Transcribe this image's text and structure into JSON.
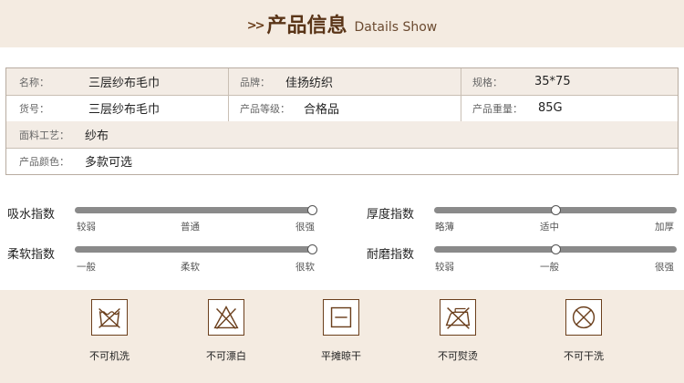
{
  "header": {
    "arrows": ">>",
    "title_zh": "产品信息",
    "title_en": "Datails  Show"
  },
  "spec": {
    "name_label": "名称：",
    "name_value": "三层纱布毛巾",
    "brand_label": "品牌：",
    "brand_value": "佳扬纺织",
    "size_label": "规格：",
    "size_value": "35*75",
    "item_no_label": "货号：",
    "item_no_value": "三层纱布毛巾",
    "grade_label": "产品等级：",
    "grade_value": "合格品",
    "weight_label": "产品重量：",
    "weight_value": "85G",
    "fabric_label": "面料工艺：",
    "fabric_value": "纱布",
    "color_label": "产品颜色：",
    "color_value": "多款可选"
  },
  "indices": [
    {
      "label": "吸水指数",
      "ticks": [
        "较弱",
        "普通",
        "很强"
      ],
      "level": 1.0
    },
    {
      "label": "厚度指数",
      "ticks": [
        "略薄",
        "适中",
        "加厚"
      ],
      "level": 0.5
    },
    {
      "label": "柔软指数",
      "ticks": [
        "一般",
        "柔软",
        "很软"
      ],
      "level": 1.0
    },
    {
      "label": "耐磨指数",
      "ticks": [
        "较弱",
        "一般",
        "很强"
      ],
      "level": 0.5
    }
  ],
  "care": [
    {
      "icon": "no-machine-wash-icon",
      "label": "不可机洗"
    },
    {
      "icon": "no-bleach-icon",
      "label": "不可漂白"
    },
    {
      "icon": "flat-dry-icon",
      "label": "平摊晾干"
    },
    {
      "icon": "no-iron-icon",
      "label": "不可熨烫"
    },
    {
      "icon": "no-dry-clean-icon",
      "label": "不可干洗"
    }
  ],
  "colors": {
    "brown": "#6b3f1c",
    "band": "#f4ebe1",
    "track": "#8a8a8a"
  }
}
